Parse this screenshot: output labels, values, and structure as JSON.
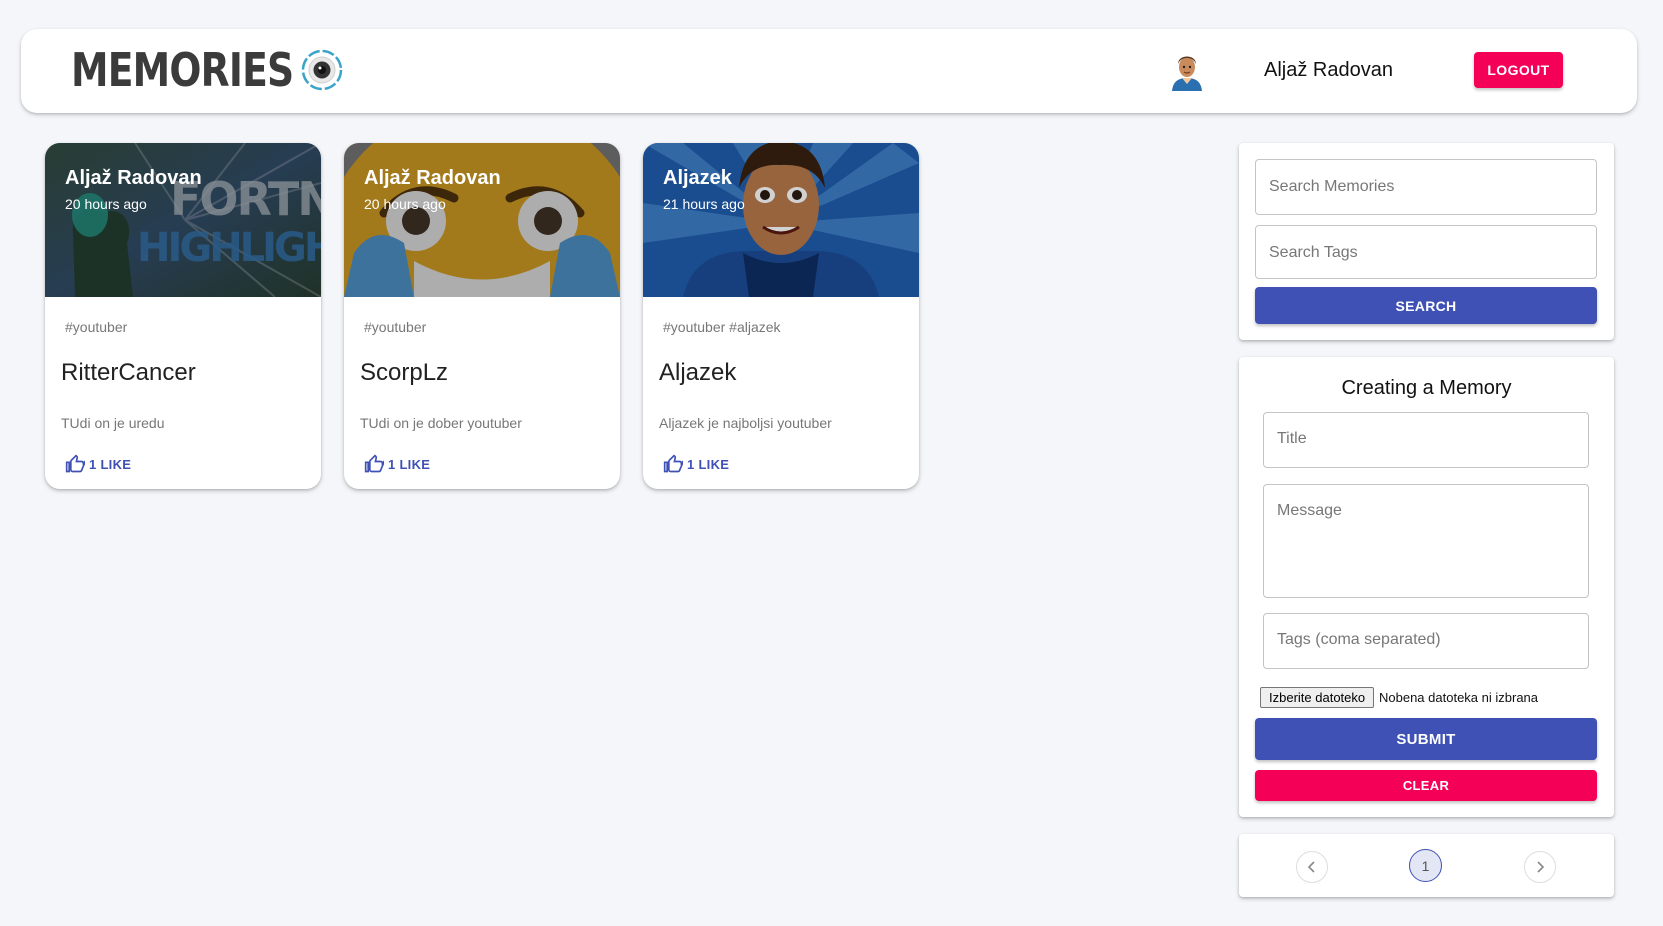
{
  "header": {
    "brand": "MEMORIES",
    "brand_icon": "memories-camera-icon",
    "user_name": "Aljaž Radovan",
    "avatar_icon": "user-avatar-icon",
    "logout_label": "LOGOUT"
  },
  "posts": [
    {
      "author": "Aljaž Radovan",
      "time": "20 hours ago",
      "tags": "#youtuber",
      "title": "RitterCancer",
      "message": "TUdi on je uredu",
      "like_label": "1 LIKE",
      "image": "fortnite-highlights-thumbnail",
      "image_text_1": "FORTNITE",
      "image_text_2": "HIGHLIGHTS"
    },
    {
      "author": "Aljaž Radovan",
      "time": "20 hours ago",
      "tags": "#youtuber",
      "title": "ScorpLz",
      "message": "TUdi on je dober youtuber",
      "like_label": "1 LIKE",
      "image": "crying-laughing-emoji-thumbnail"
    },
    {
      "author": "Aljazek",
      "time": "21 hours ago",
      "tags": "#youtuber #aljazek",
      "title": "Aljazek",
      "message": "Aljazek je najboljsi youtuber",
      "like_label": "1 LIKE",
      "image": "cartoon-boy-thumbnail"
    }
  ],
  "search": {
    "memories_placeholder": "Search Memories",
    "tags_placeholder": "Search Tags",
    "button_label": "SEARCH"
  },
  "form": {
    "title": "Creating a Memory",
    "title_placeholder": "Title",
    "message_placeholder": "Message",
    "tags_placeholder": "Tags (coma separated)",
    "file_button": "Izberite datoteko",
    "file_status": "Nobena datoteka ni izbrana",
    "submit_label": "SUBMIT",
    "clear_label": "CLEAR"
  },
  "pagination": {
    "current_page": "1"
  },
  "colors": {
    "primary": "#3f51b5",
    "secondary": "#f50057",
    "background": "#f5f6fa"
  }
}
